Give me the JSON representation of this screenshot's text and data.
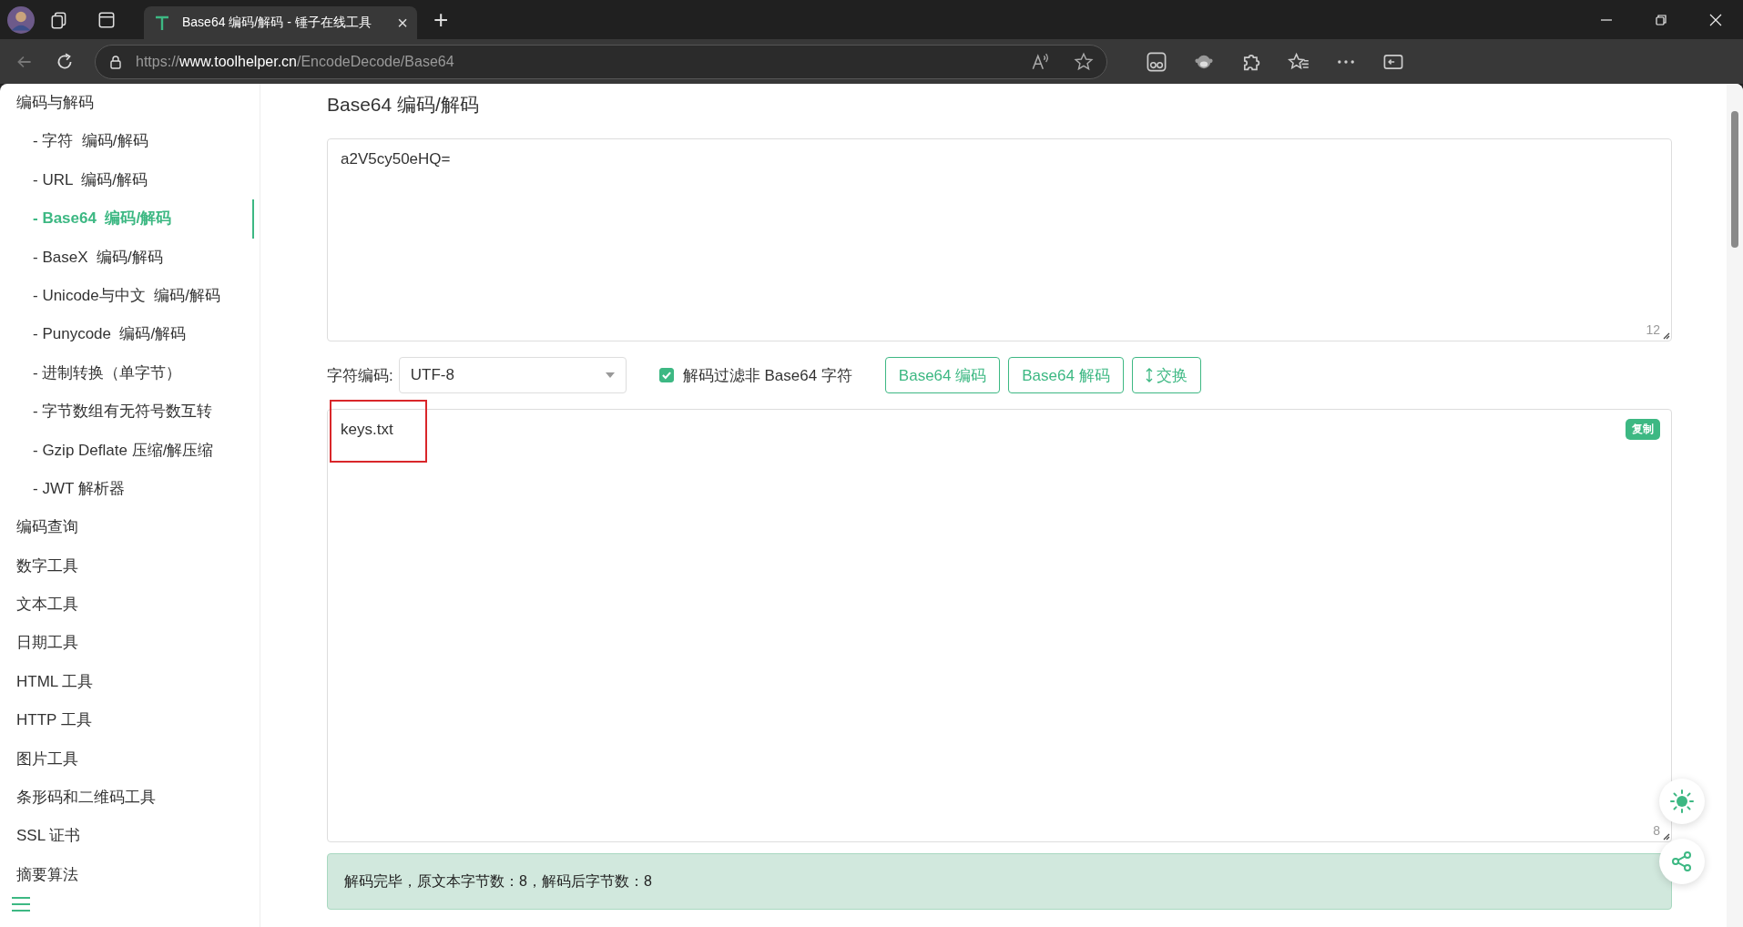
{
  "browser": {
    "tab": {
      "title": "Base64 编码/解码 - 锤子在线工具",
      "close": "×",
      "selected": true
    },
    "new_tab": "+",
    "url": {
      "scheme": "https://",
      "host": "www.toolhelper.cn",
      "path": "/EncodeDecode/Base64"
    }
  },
  "sidebar": {
    "items": [
      {
        "label": "编码与解码",
        "selected": false,
        "children": [
          {
            "label": "- 字符  编码/解码",
            "selected": false
          },
          {
            "label": "- URL  编码/解码",
            "selected": false
          },
          {
            "label": "- Base64  编码/解码",
            "selected": true
          },
          {
            "label": "- BaseX  编码/解码",
            "selected": false
          },
          {
            "label": "- Unicode与中文  编码/解码",
            "selected": false
          },
          {
            "label": "- Punycode  编码/解码",
            "selected": false
          },
          {
            "label": "- 进制转换（单字节）",
            "selected": false
          },
          {
            "label": "- 字节数组有无符号数互转",
            "selected": false
          },
          {
            "label": "- Gzip Deflate 压缩/解压缩",
            "selected": false
          },
          {
            "label": "- JWT 解析器",
            "selected": false
          }
        ]
      },
      {
        "label": "编码查询",
        "selected": false
      },
      {
        "label": "数字工具",
        "selected": false
      },
      {
        "label": "文本工具",
        "selected": false
      },
      {
        "label": "日期工具",
        "selected": false
      },
      {
        "label": "HTML 工具",
        "selected": false
      },
      {
        "label": "HTTP 工具",
        "selected": false
      },
      {
        "label": "图片工具",
        "selected": false
      },
      {
        "label": "条形码和二维码工具",
        "selected": false
      },
      {
        "label": "SSL 证书",
        "selected": false
      },
      {
        "label": "摘要算法",
        "selected": false
      }
    ]
  },
  "page": {
    "title": "Base64 编码/解码",
    "input": {
      "value": "a2V5cy50eHQ=",
      "count": "12"
    },
    "options": {
      "encoding_label": "字符编码:",
      "encoding": "UTF-8",
      "filter": {
        "label": "解码过滤非 Base64 字符",
        "checked": true
      },
      "buttons": [
        {
          "label": "Base64 编码",
          "kind": "plain"
        },
        {
          "label": "Base64 解码",
          "kind": "plain"
        },
        {
          "label": "交换",
          "kind": "swap"
        }
      ]
    },
    "output": {
      "value": "keys.txt",
      "count": "8",
      "copy": "复制",
      "highlighted": true
    },
    "status": "解码完毕，原文本字节数：8，解码后字节数：8"
  }
}
